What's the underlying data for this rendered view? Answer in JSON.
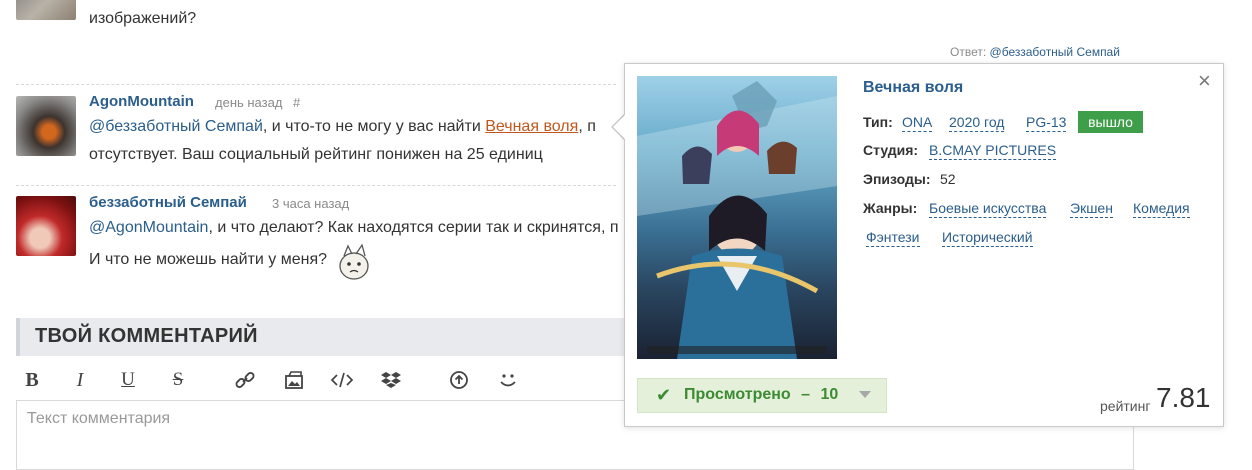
{
  "top_comment": {
    "line": "изображений?",
    "reply_prefix": "Ответ:",
    "reply_to": "@беззаботный Семпай"
  },
  "comments": [
    {
      "user": "AgonMountain",
      "time": "день назад",
      "hash": "#",
      "mention": "@беззаботный Семпай",
      "text_a": ", и что-то не могу у вас найти",
      "anime_link": "Вечная воля",
      "text_b": ", п",
      "line2": "отсутствует. Ваш социальный рейтинг понижен на 25 единиц"
    },
    {
      "user": "беззаботный Семпай",
      "time": "3 часа назад",
      "mention": "@AgonMountain",
      "text_a": ", и что делают? Как находятся серии так и скринятся, п",
      "line2": "И что не можешь найти у меня?"
    }
  ],
  "comment_form": {
    "title": "ТВОЙ КОММЕНТАРИЙ",
    "placeholder": "Текст комментария",
    "toolbar": [
      "bold-icon",
      "italic-icon",
      "underline-icon",
      "strike-icon",
      "link-icon",
      "image-icon",
      "code-icon",
      "dropbox-icon",
      "upload-icon",
      "smile-icon"
    ]
  },
  "popup": {
    "title": "Вечная воля",
    "type_label": "Тип:",
    "type": "ONA",
    "year": "2020 год",
    "rating_age": "PG-13",
    "status": "вышло",
    "studio_label": "Студия:",
    "studio": "B.CMAY PICTURES",
    "episodes_label": "Эпизоды:",
    "episodes": "52",
    "genres_label": "Жанры:",
    "genres": [
      "Боевые искусства",
      "Экшен",
      "Комедия",
      "Фэнтези",
      "Исторический"
    ],
    "watched_label": "Просмотрено",
    "watched_dash": "–",
    "watched_count": "10",
    "rating_label": "рейтинг",
    "rating": "7.81",
    "colors": {
      "accent_blue": "#2b5e8c",
      "status_green": "#3f9e4a",
      "watched_bg": "#e4f0d9"
    }
  }
}
